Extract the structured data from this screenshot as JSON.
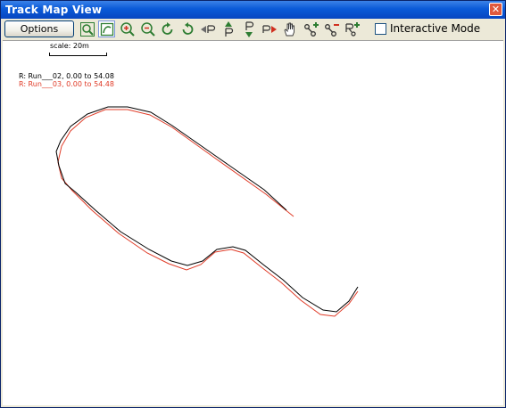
{
  "window": {
    "title": "Track Map View",
    "close_glyph": "✕"
  },
  "toolbar": {
    "options_label": "Options",
    "icons": [
      "zoom-fit-icon",
      "auto-draw-icon",
      "zoom-in-icon",
      "zoom-out-icon",
      "rotate-clockwise-icon",
      "rotate-counterclockwise-icon",
      "previous-point-icon",
      "move-up-point-icon",
      "move-down-point-icon",
      "next-point-icon",
      "pan-hand-icon",
      "add-node-icon",
      "remove-node-icon",
      "add-reference-icon"
    ],
    "interactive_mode_label": "Interactive Mode",
    "interactive_mode_checked": false
  },
  "map": {
    "scale_label": "scale: 20m",
    "runs": [
      {
        "text": "R:  Run___02, 0.00 to 54.08",
        "color": "#000000"
      },
      {
        "text": "R:  Run___03, 0.00 to 54.48",
        "color": "#e03c28"
      }
    ]
  },
  "colors": {
    "title_bar": "#0a5ad8",
    "run_02": "#000000",
    "run_03": "#e03c28",
    "icon_green": "#2e7d32"
  }
}
